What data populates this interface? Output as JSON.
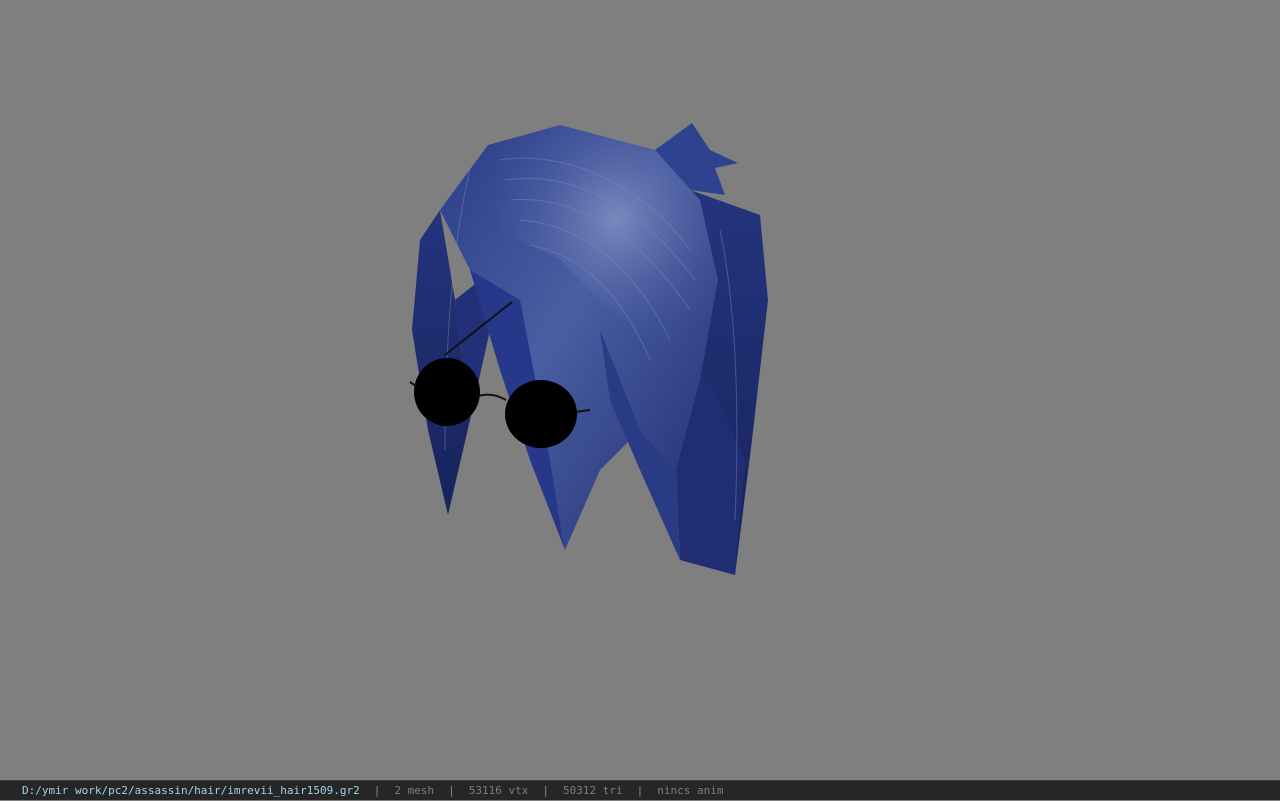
{
  "viewport": {
    "background_color": "#7f7f7f",
    "model_icon": "hair-mesh-icon",
    "accessory_icon": "sunglasses-icon",
    "hair_color": "#2a3a85",
    "hair_highlight_color": "#6f80b8",
    "glasses_color": "#000000"
  },
  "statusbar": {
    "file_path": "D:/ymir work/pc2/assassin/hair/imrevii_hair1509.gr2",
    "separator": "|",
    "mesh_count": "2 mesh",
    "vertex_count": "53116 vtx",
    "triangle_count": "50312 tri",
    "anim_status": "nincs anim",
    "path_color": "#9fd4ea",
    "text_color": "#7c7c7c"
  }
}
